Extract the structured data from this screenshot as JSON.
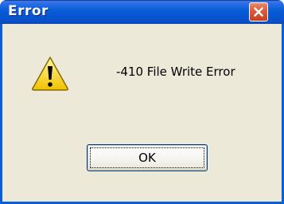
{
  "window": {
    "title": "Error",
    "colors": {
      "titlebar": "#0a5fd8",
      "close": "#dd5a38",
      "face": "#ece9d8"
    }
  },
  "dialog": {
    "icon": "warning-icon",
    "message": "-410 File Write Error",
    "ok_label": "OK"
  }
}
